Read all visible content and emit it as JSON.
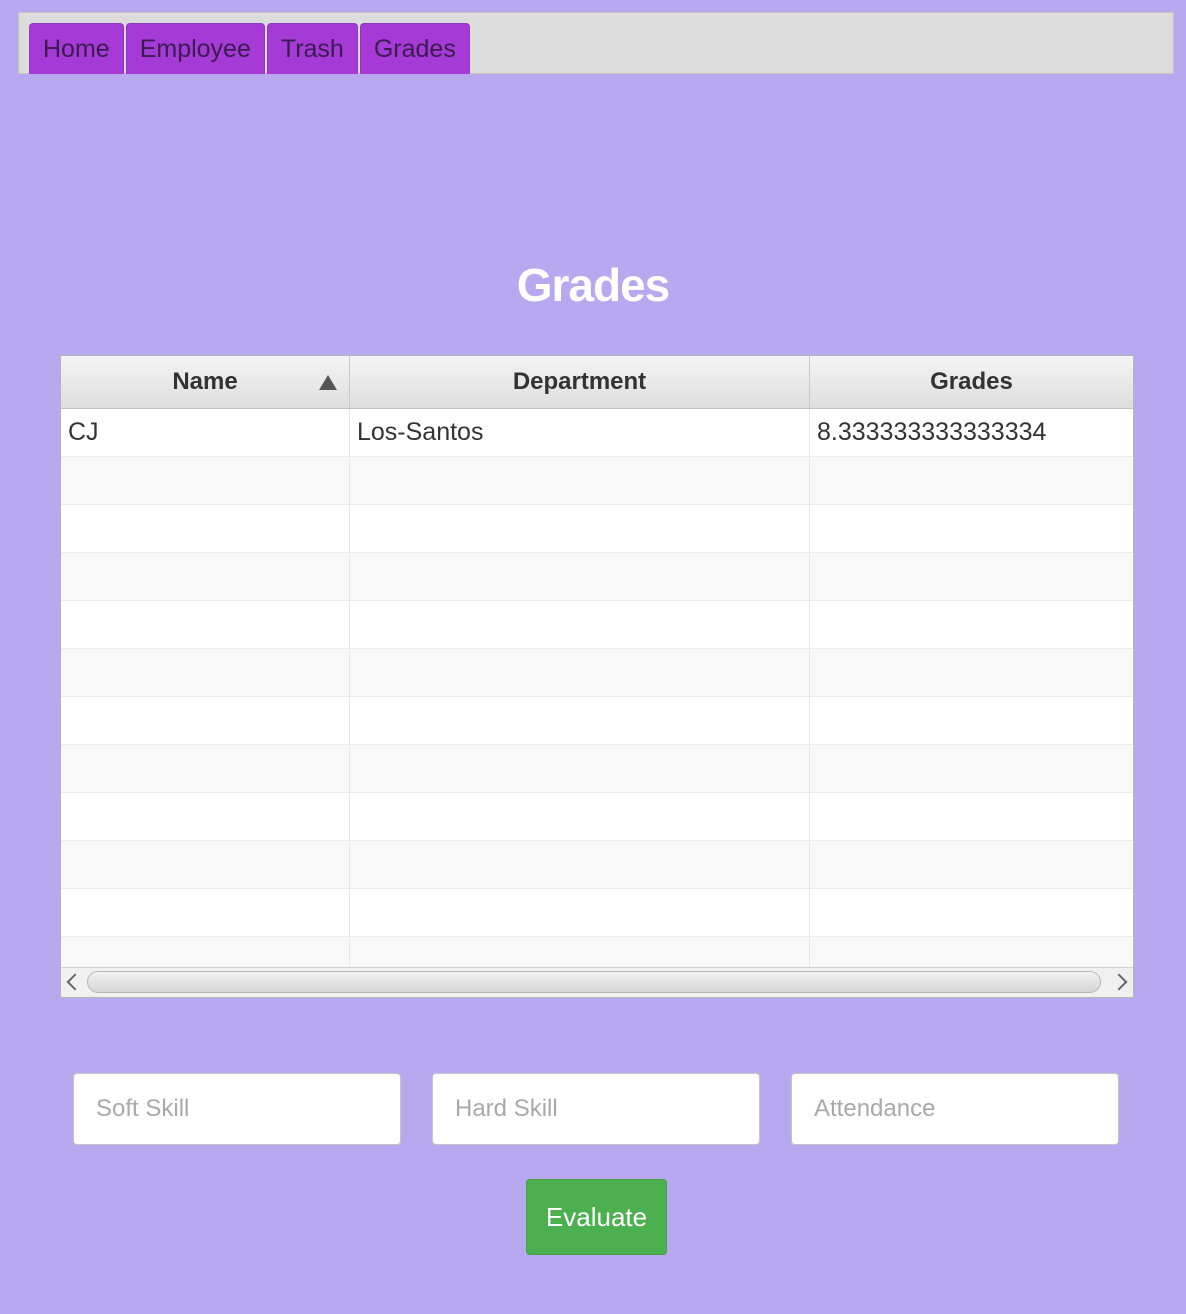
{
  "tabs": [
    {
      "label": "Home"
    },
    {
      "label": "Employee"
    },
    {
      "label": "Trash"
    },
    {
      "label": "Grades"
    }
  ],
  "page": {
    "title": "Grades"
  },
  "table": {
    "columns": [
      "Name",
      "Department",
      "Grades"
    ],
    "sort": {
      "column": "Name",
      "direction": "ascending"
    },
    "rows": [
      [
        "CJ",
        "Los-Santos",
        "8.333333333333334"
      ],
      [
        "",
        "",
        ""
      ],
      [
        "",
        "",
        ""
      ],
      [
        "",
        "",
        ""
      ],
      [
        "",
        "",
        ""
      ],
      [
        "",
        "",
        ""
      ],
      [
        "",
        "",
        ""
      ],
      [
        "",
        "",
        ""
      ],
      [
        "",
        "",
        ""
      ],
      [
        "",
        "",
        ""
      ],
      [
        "",
        "",
        ""
      ],
      [
        "",
        "",
        ""
      ]
    ]
  },
  "form": {
    "soft_skill_placeholder": "Soft Skill",
    "hard_skill_placeholder": "Hard Skill",
    "attendance_placeholder": "Attendance",
    "soft_skill_value": "",
    "hard_skill_value": "",
    "attendance_value": "",
    "evaluate_label": "Evaluate"
  },
  "colors": {
    "background": "#b8a8ef",
    "tab": "#a63ad6",
    "evaluate_button": "#4caf50"
  }
}
